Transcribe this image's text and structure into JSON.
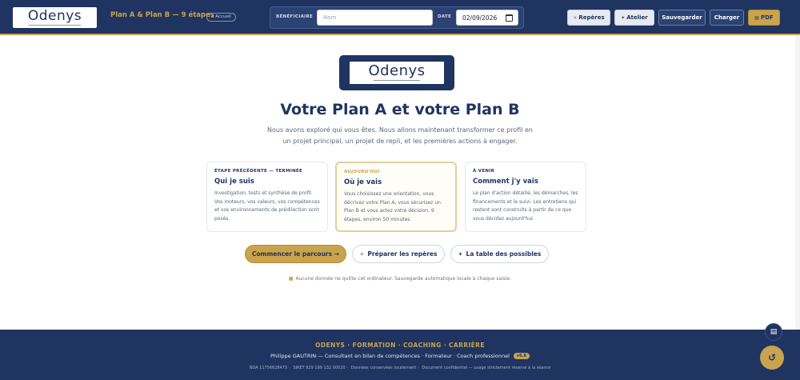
{
  "header": {
    "logo_text": "Odenys",
    "plan_title": "Plan A & Plan B — 9 étapes",
    "home_label": "⌂ Accueil",
    "beneficiary_label": "BÉNÉFICIAIRE",
    "name_placeholder": "Nom",
    "name_value": "",
    "date_label": "DATE",
    "date_value": "02/09/2026",
    "buttons": {
      "reperes": "Repères",
      "atelier": "Atelier",
      "sauvegarder": "Sauvegarder",
      "charger": "Charger",
      "pdf": "PDF"
    }
  },
  "hero": {
    "logo_text": "Odenys",
    "title": "Votre Plan A et votre Plan B",
    "intro": "Nous avons exploré qui vous êtes. Nous allons maintenant transformer ce profil en un projet principal, un projet de repli, et les premières actions à engager."
  },
  "cards": [
    {
      "step": "ÉTAPE PRÉCÉDENTE — TERMINÉE",
      "title": "Qui je suis",
      "text": "Investigation, tests et synthèse de profil. Vos moteurs, vos valeurs, vos compétences et vos environnements de prédilection sont posés."
    },
    {
      "step": "AUJOURD'HUI",
      "title": "Où je vais",
      "text": "Vous choisissez une orientation, vous décrivez votre Plan A, vous sécurisez un Plan B et vous actez votre décision. 9 étapes, environ 50 minutes."
    },
    {
      "step": "À VENIR",
      "title": "Comment j'y vais",
      "text": "Le plan d'action détaillé, les démarches, les financements et le suivi. Les entretiens qui restent sont construits à partir de ce que vous décidez aujourd'hui."
    }
  ],
  "actions": {
    "start": "Commencer le parcours →",
    "prepare": "Préparer les repères",
    "table": "La table des possibles"
  },
  "privacy": "Aucune donnée ne quitte cet ordinateur. Sauvegarde automatique locale à chaque saisie.",
  "footer": {
    "brand": "ODENYS · FORMATION · COACHING · CARRIÈRE",
    "line2": "Philippe GAUTRIN — Consultant en bilan de compétences · Formateur · Coach professionnel",
    "version": "v5.8",
    "nda": "NDA 11756628475",
    "siret": "SIRET 829 199 132 00020",
    "data": "Données conservées localement",
    "confidential": "Document confidentiel — usage strictement réservé à la séance"
  },
  "icons": {
    "reperes": "compass-icon",
    "atelier": "sparkle-icon",
    "pdf": "document-icon",
    "lock": "lock-icon"
  },
  "colors": {
    "navy": "#1f3461",
    "gold": "#c9a44c"
  }
}
